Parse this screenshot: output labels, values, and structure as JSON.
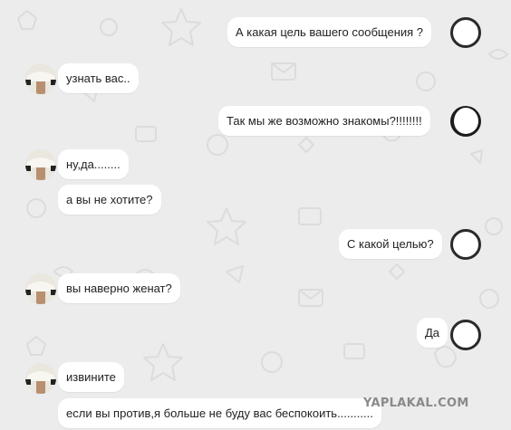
{
  "messages": [
    {
      "side": "right",
      "text": "А какая цель вашего сообщения ?"
    },
    {
      "side": "left",
      "text": "узнать вас.."
    },
    {
      "side": "right",
      "text": "Так мы же возможно знакомы?!!!!!!!!"
    },
    {
      "side": "left",
      "text": "ну,да........"
    },
    {
      "side": "left",
      "text": "а вы не хотите?"
    },
    {
      "side": "right",
      "text": "С какой целью?"
    },
    {
      "side": "left",
      "text": "вы наверно женат?"
    },
    {
      "side": "right",
      "text": "Да"
    },
    {
      "side": "left",
      "text": "извините"
    },
    {
      "side": "left",
      "text": "если вы против,я больше не буду вас беспокоить..........."
    }
  ],
  "watermark": "YAPLAKAL.COM",
  "colors": {
    "background": "#ececec",
    "bubble": "#ffffff",
    "text": "#222222"
  }
}
